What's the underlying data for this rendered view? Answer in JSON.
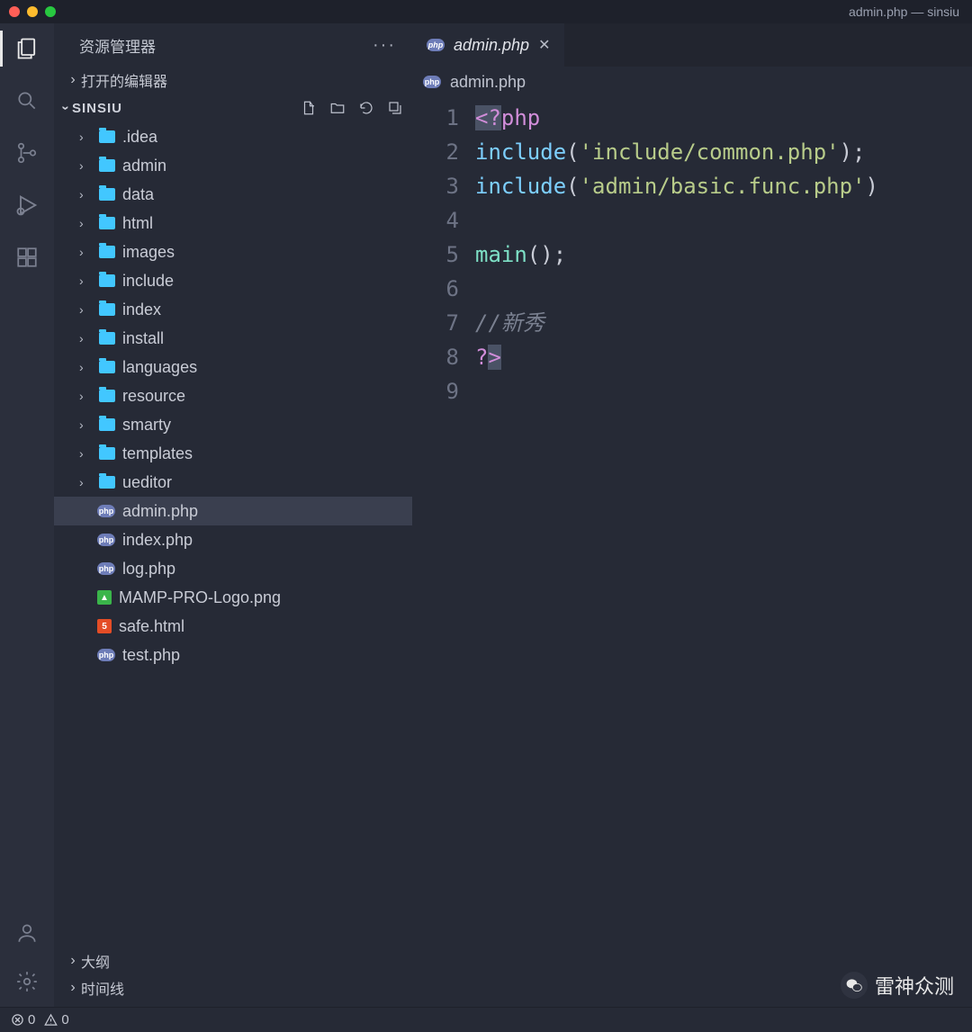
{
  "window": {
    "title": "admin.php — sinsiu"
  },
  "explorer": {
    "title": "资源管理器",
    "sections": {
      "open_editors": "打开的编辑器",
      "outline": "大纲",
      "timeline": "时间线"
    },
    "project_name": "SINSIU",
    "folders": [
      ".idea",
      "admin",
      "data",
      "html",
      "images",
      "include",
      "index",
      "install",
      "languages",
      "resource",
      "smarty",
      "templates",
      "ueditor"
    ],
    "files": [
      {
        "name": "admin.php",
        "type": "php",
        "selected": true
      },
      {
        "name": "index.php",
        "type": "php",
        "selected": false
      },
      {
        "name": "log.php",
        "type": "php",
        "selected": false
      },
      {
        "name": "MAMP-PRO-Logo.png",
        "type": "img",
        "selected": false
      },
      {
        "name": "safe.html",
        "type": "html",
        "selected": false
      },
      {
        "name": "test.php",
        "type": "php",
        "selected": false
      }
    ]
  },
  "tabs": [
    {
      "label": "admin.php",
      "icon": "php"
    }
  ],
  "breadcrumb": {
    "file": "admin.php"
  },
  "code": {
    "lines": [
      "1",
      "2",
      "3",
      "4",
      "5",
      "6",
      "7",
      "8",
      "9"
    ],
    "l1_open": "<?",
    "l1_php": "php",
    "l2_kw": "include",
    "l2_p1": "(",
    "l2_str": "'include/common.php'",
    "l2_p2": ");",
    "l3_kw": "include",
    "l3_p1": "(",
    "l3_str": "'admin/basic.func.php'",
    "l3_p2": ")",
    "l5_fn": "main",
    "l5_p": "();",
    "l7": "//新秀",
    "l8_q": "?",
    "l8_gt": ">"
  },
  "status": {
    "errors": "0",
    "warnings": "0"
  },
  "watermark": {
    "text": "雷神众测"
  }
}
